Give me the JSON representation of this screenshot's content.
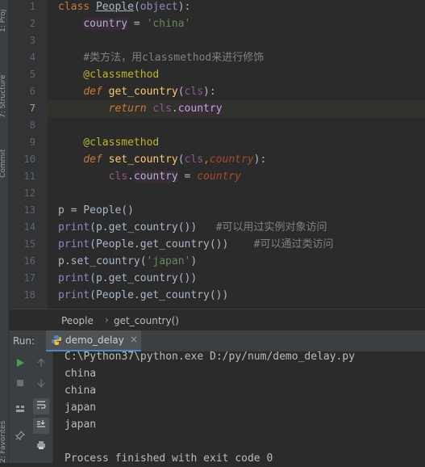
{
  "side_strip": {
    "labels": [
      "1: Proj",
      "7: Structure",
      "Commit",
      "2: Favorites"
    ]
  },
  "editor": {
    "line_numbers": [
      "1",
      "2",
      "3",
      "4",
      "5",
      "6",
      "7",
      "8",
      "9",
      "10",
      "11",
      "12",
      "13",
      "14",
      "15",
      "16",
      "17",
      "18"
    ],
    "current_line": 7,
    "lines": [
      [
        {
          "t": "class ",
          "c": "kw"
        },
        {
          "t": "People",
          "c": "cls-name"
        },
        {
          "t": "(",
          "c": "plain"
        },
        {
          "t": "object",
          "c": "builtin"
        },
        {
          "t": "):",
          "c": "plain"
        }
      ],
      [
        {
          "t": "    ",
          "c": "plain"
        },
        {
          "t": "country",
          "c": "attr-hl"
        },
        {
          "t": " = ",
          "c": "plain"
        },
        {
          "t": "'china'",
          "c": "str"
        }
      ],
      [],
      [
        {
          "t": "    #类方法，用classmethod来进行修饰",
          "c": "cmt"
        }
      ],
      [
        {
          "t": "    @classmethod",
          "c": "dec"
        }
      ],
      [
        {
          "t": "    ",
          "c": "plain"
        },
        {
          "t": "def ",
          "c": "kw-i"
        },
        {
          "t": "get_country",
          "c": "fn"
        },
        {
          "t": "(",
          "c": "plain"
        },
        {
          "t": "cls",
          "c": "self"
        },
        {
          "t": "):",
          "c": "plain"
        }
      ],
      [
        {
          "t": "        ",
          "c": "plain"
        },
        {
          "t": "return ",
          "c": "kw-i"
        },
        {
          "t": "cls",
          "c": "self"
        },
        {
          "t": ".",
          "c": "plain"
        },
        {
          "t": "country",
          "c": "attr-hl"
        }
      ],
      [],
      [
        {
          "t": "    @classmethod",
          "c": "dec"
        }
      ],
      [
        {
          "t": "    ",
          "c": "plain"
        },
        {
          "t": "def ",
          "c": "kw-i"
        },
        {
          "t": "set_country",
          "c": "fn"
        },
        {
          "t": "(",
          "c": "plain"
        },
        {
          "t": "cls",
          "c": "self"
        },
        {
          "t": ",",
          "c": "kw"
        },
        {
          "t": "country",
          "c": "param"
        },
        {
          "t": "):",
          "c": "plain"
        }
      ],
      [
        {
          "t": "        ",
          "c": "plain"
        },
        {
          "t": "cls",
          "c": "self"
        },
        {
          "t": ".",
          "c": "plain"
        },
        {
          "t": "country",
          "c": "attr-hl"
        },
        {
          "t": " = ",
          "c": "plain"
        },
        {
          "t": "country",
          "c": "param"
        }
      ],
      [],
      [
        {
          "t": "p = People()",
          "c": "plain"
        }
      ],
      [
        {
          "t": "print",
          "c": "builtin"
        },
        {
          "t": "(p.get_country())   ",
          "c": "plain"
        },
        {
          "t": "#可以用过实例对象访问",
          "c": "cmt"
        }
      ],
      [
        {
          "t": "print",
          "c": "builtin"
        },
        {
          "t": "(People.get_country())    ",
          "c": "plain"
        },
        {
          "t": "#可以通过类访问",
          "c": "cmt"
        }
      ],
      [
        {
          "t": "p.set_country(",
          "c": "plain"
        },
        {
          "t": "'japan'",
          "c": "str"
        },
        {
          "t": ")",
          "c": "plain"
        }
      ],
      [
        {
          "t": "print",
          "c": "builtin"
        },
        {
          "t": "(p.get_country())",
          "c": "plain"
        }
      ],
      [
        {
          "t": "print",
          "c": "builtin"
        },
        {
          "t": "(People.get_country())",
          "c": "plain"
        }
      ]
    ]
  },
  "breadcrumb": {
    "items": [
      "People",
      "get_country()"
    ],
    "separator": "›"
  },
  "run_panel": {
    "label": "Run:",
    "tab_label": "demo_delay",
    "tab_close": "×",
    "console_lines": [
      "C:\\Python37\\python.exe D:/py/num/demo_delay.py",
      "china",
      "china",
      "japan",
      "japan",
      "",
      "Process finished with exit code 0"
    ]
  },
  "colors": {
    "background": "#2b2b2b",
    "keyword": "#cc7832",
    "string": "#6a8759",
    "comment": "#808080",
    "decorator": "#bbb529",
    "function": "#ffc66d",
    "run_green": "#499c54",
    "tab_underline": "#4a88c7"
  },
  "icons": {
    "run": "play-icon",
    "stop": "stop-icon",
    "up": "arrow-up-icon",
    "down": "arrow-down-icon",
    "wrap": "soft-wrap-icon",
    "scroll_end": "scroll-to-end-icon",
    "layout": "layout-icon",
    "print": "print-icon",
    "pin": "pin-icon",
    "python": "python-icon"
  }
}
